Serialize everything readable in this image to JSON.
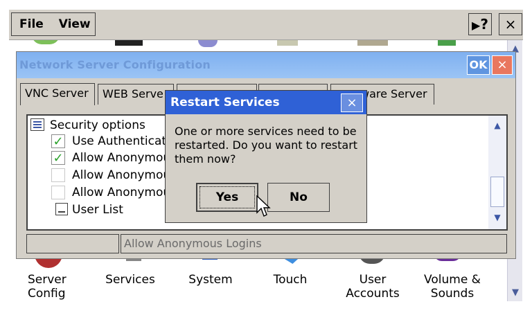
{
  "menubar": {
    "file_label": "File",
    "view_label": "View",
    "help_icon": "help-pointer-icon",
    "help_label": "?",
    "close_label": "×"
  },
  "control_panel": {
    "icons": [
      {
        "label": "Server\nConfig",
        "icon": "server-config-icon"
      },
      {
        "label": "Services",
        "icon": "services-icon"
      },
      {
        "label": "System",
        "icon": "system-icon"
      },
      {
        "label": "Touch",
        "icon": "touch-icon"
      },
      {
        "label": "User\nAccounts",
        "icon": "user-accounts-icon"
      },
      {
        "label": "Volume &\nSounds",
        "icon": "volume-sounds-icon"
      }
    ]
  },
  "nsc_dialog": {
    "title": "Network Server Configuration",
    "ok_label": "OK",
    "close_label": "×",
    "tabs": [
      "VNC Server",
      "WEB Serve",
      "",
      "",
      "ware Server"
    ],
    "tree": {
      "root_label": "Security options",
      "items": [
        {
          "label": "Use Authenticat",
          "checked": true
        },
        {
          "label": "Allow Anonymou",
          "checked": true
        },
        {
          "label": "Allow Anonymou",
          "checked": false
        },
        {
          "label": "Allow Anonymou",
          "checked": false
        },
        {
          "label": "User List",
          "checked": false
        }
      ]
    },
    "status_text": "Allow Anonymous Logins"
  },
  "restart_dialog": {
    "title": "Restart Services",
    "close_label": "×",
    "message": "One or more services need to be restarted. Do you want to restart them now?",
    "yes_label": "Yes",
    "no_label": "No"
  },
  "colors": {
    "title_active": "#2f61d6",
    "title_inactive": "#9bc4f5",
    "check": "#2aa12a"
  }
}
